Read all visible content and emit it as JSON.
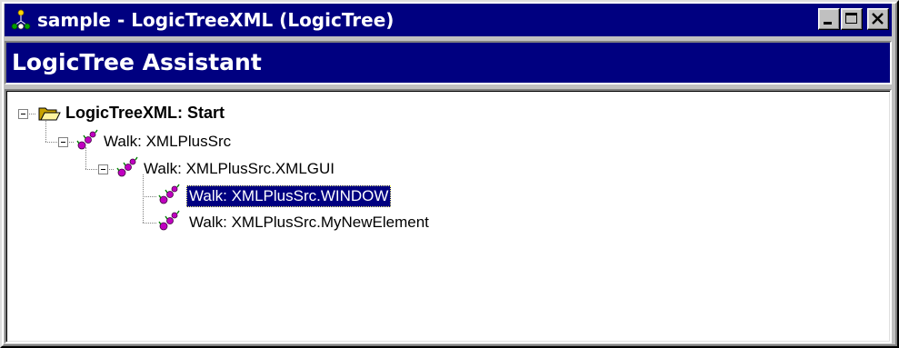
{
  "window": {
    "title": "sample - LogicTreeXML (LogicTree)",
    "buttons": {
      "minimize_icon": "minimize-icon",
      "maximize_icon": "maximize-icon",
      "close_icon": "close-icon"
    }
  },
  "banner": {
    "title": "LogicTree Assistant"
  },
  "tree": {
    "root": {
      "label": "LogicTreeXML: Start",
      "icon": "open-folder-icon",
      "expanded": true
    },
    "nodes": [
      {
        "label": "Walk: XMLPlusSrc",
        "icon": "walk-icon",
        "expanded": true,
        "selected": false
      },
      {
        "label": "Walk: XMLPlusSrc.XMLGUI",
        "icon": "walk-icon",
        "expanded": true,
        "selected": false
      },
      {
        "label": "Walk: XMLPlusSrc.WINDOW",
        "icon": "walk-icon",
        "expanded": false,
        "selected": true
      },
      {
        "label": "Walk: XMLPlusSrc.MyNewElement",
        "icon": "walk-icon",
        "expanded": false,
        "selected": false
      }
    ]
  },
  "colors": {
    "titlebar": "#000080",
    "selection": "#000080",
    "chrome": "#c0c0c0",
    "panel": "#ffffff"
  }
}
